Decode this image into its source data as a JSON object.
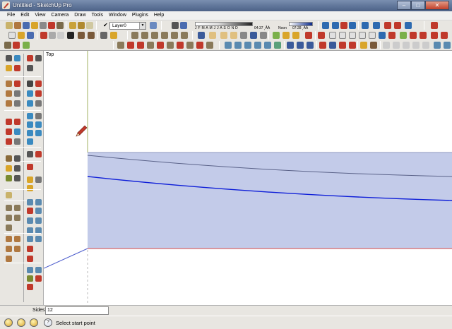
{
  "window": {
    "title": "Untitled - SketchUp Pro",
    "controls": [
      "–",
      "□",
      "✕"
    ]
  },
  "menu": [
    "File",
    "Edit",
    "View",
    "Camera",
    "Draw",
    "Tools",
    "Window",
    "Plugins",
    "Help"
  ],
  "layer": {
    "current": "Layer0",
    "check": "✔"
  },
  "shadows": {
    "months": "J F M A M J J A S O N D",
    "time_start": "04:37 ¸ÂÀ",
    "noon": "Noon",
    "time_end": "07:28 ¸ÀÄ"
  },
  "viewport": {
    "scene_label": "Top"
  },
  "vcb": {
    "label": "Sides",
    "value": "12"
  },
  "status": {
    "message": "Select start point",
    "icons": [
      "help-circle-icon",
      "geo-location-icon",
      "credits-icon",
      "question-icon"
    ]
  },
  "colors": {
    "accent_title": "#5d7397",
    "selection_fill": "#c3cbe9",
    "blue_axis": "#0e1ed8",
    "red_axis": "#d03030",
    "green_axis": "#7a8a30"
  }
}
